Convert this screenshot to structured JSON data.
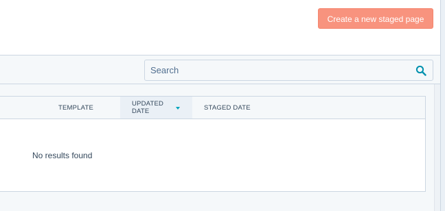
{
  "header": {
    "create_button_label": "Create a new staged page",
    "accent_color": "#f8937e"
  },
  "search": {
    "placeholder": "Search",
    "value": "",
    "icon": "search-icon"
  },
  "table": {
    "columns": [
      {
        "label": "TEMPLATE"
      },
      {
        "label": "UPDATED DATE",
        "sorted": true,
        "sort_icon": "sort-descending-icon"
      },
      {
        "label": "STAGED DATE"
      }
    ],
    "empty_message": "No results found"
  }
}
